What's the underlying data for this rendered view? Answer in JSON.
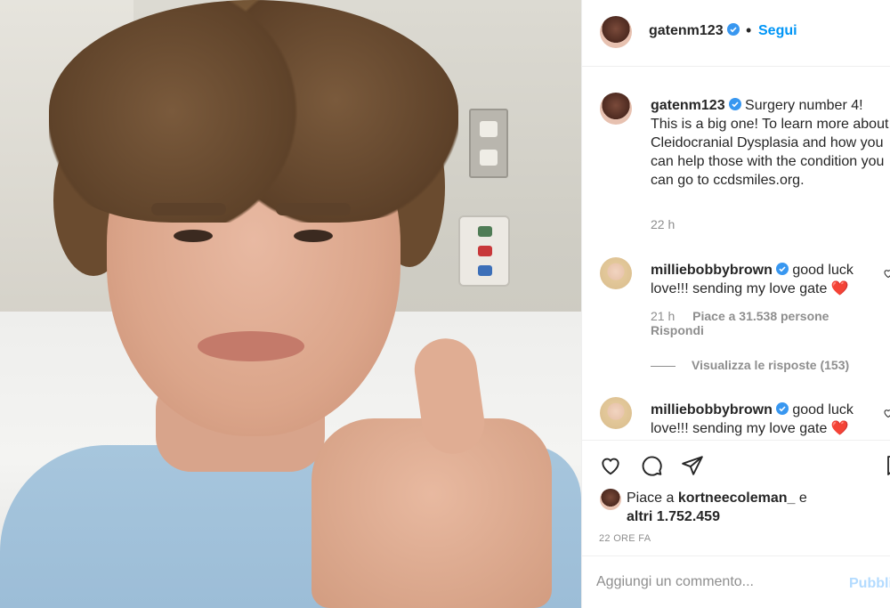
{
  "post": {
    "author": "gatenm123",
    "follow_label": "Segui",
    "separator": "•"
  },
  "caption": {
    "username": "gatenm123",
    "text": "Surgery number 4! This is a big one! To learn more about Cleidocranial Dysplasia and how you can help those with the condition you can go to ccdsmiles.org.",
    "time": "22 h"
  },
  "comments": [
    {
      "username": "milliebobbybrown",
      "text": "good luck love!!! sending my love gate ❤️",
      "time": "21 h",
      "likes": "Piace a 31.538 persone",
      "reply_label": "Rispondi",
      "view_replies": "Visualizza le risposte (153)"
    },
    {
      "username": "milliebobbybrown",
      "text": "good luck love!!! sending my love gate ❤️"
    }
  ],
  "likes_summary": {
    "prefix": "Piace a",
    "user": "kortneecoleman_",
    "conj": "e",
    "others": "altri 1.752.459"
  },
  "posted_time": "22 ORE FA",
  "add_comment": {
    "placeholder": "Aggiungi un commento...",
    "publish_label": "Pubblica"
  },
  "icons": {
    "verified": "verified-badge-icon",
    "like": "heart-icon",
    "comment": "comment-icon",
    "share": "share-icon",
    "save": "bookmark-icon"
  },
  "colors": {
    "link": "#0095f6",
    "verified": "#3897f0",
    "heart": "#ed4956",
    "muted": "#8e8e8e"
  }
}
